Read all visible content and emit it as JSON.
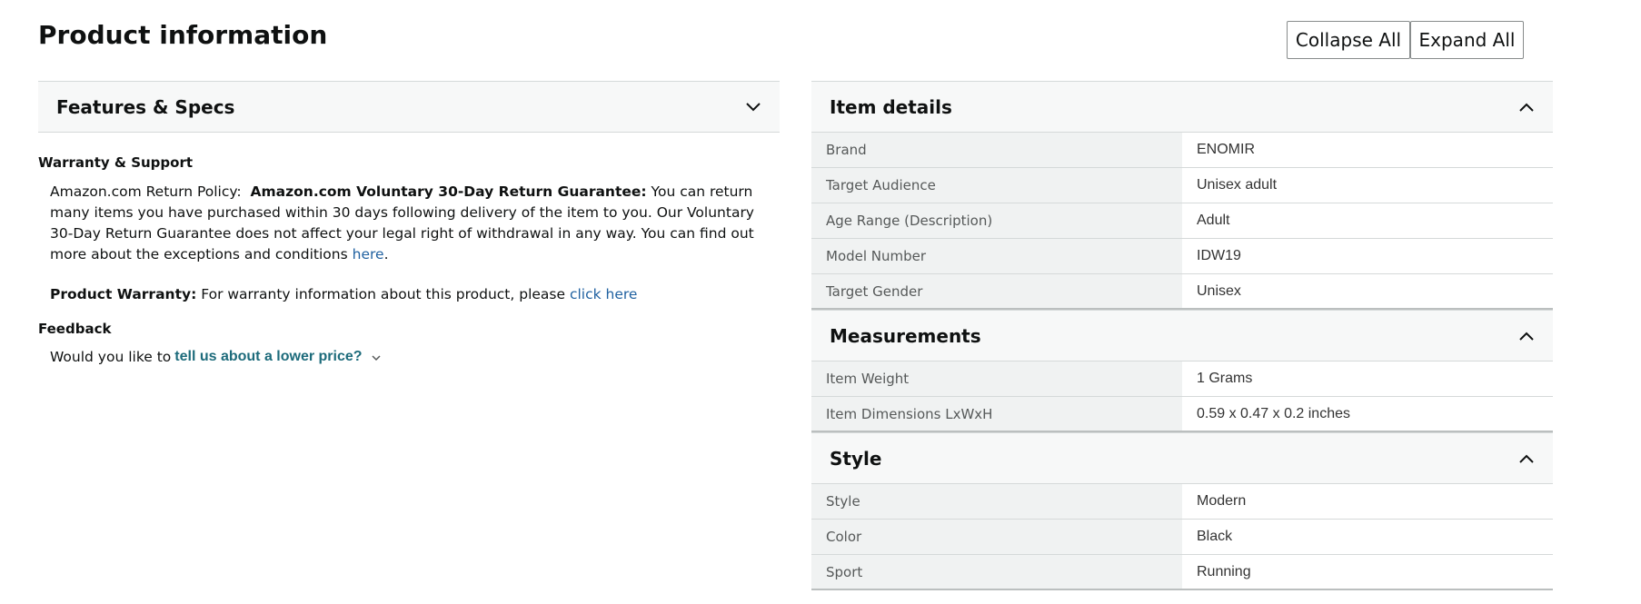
{
  "page": {
    "title": "Product information"
  },
  "buttons": {
    "collapse_all": "Collapse All",
    "expand_all": "Expand All"
  },
  "left": {
    "features_header": "Features & Specs",
    "warranty_support": {
      "title": "Warranty & Support",
      "return_policy_label": "Amazon.com Return Policy:",
      "return_policy_bold": "Amazon.com Voluntary 30-Day Return Guarantee:",
      "return_policy_text": "You can return many items you have purchased within 30 days following delivery of the item to you. Our Voluntary 30-Day Return Guarantee does not affect your legal right of withdrawal in any way. You can find out more about the exceptions and conditions",
      "here_link": "here",
      "period": ".",
      "warranty_label": "Product Warranty:",
      "warranty_text": "For warranty information about this product, please",
      "click_here_link": "click here"
    },
    "feedback": {
      "title": "Feedback",
      "prompt": "Would you like to",
      "link": "tell us about a lower price?"
    }
  },
  "right": {
    "item_details": {
      "header": "Item details",
      "rows": [
        {
          "key": "Brand",
          "value": "ENOMIR"
        },
        {
          "key": "Target Audience",
          "value": "Unisex adult"
        },
        {
          "key": "Age Range (Description)",
          "value": "Adult"
        },
        {
          "key": "Model Number",
          "value": "IDW19"
        },
        {
          "key": "Target Gender",
          "value": "Unisex"
        }
      ]
    },
    "measurements": {
      "header": "Measurements",
      "rows": [
        {
          "key": "Item Weight",
          "value": "1 Grams"
        },
        {
          "key": "Item Dimensions LxWxH",
          "value": "0.59 x 0.47 x 0.2 inches"
        }
      ]
    },
    "style": {
      "header": "Style",
      "rows": [
        {
          "key": "Style",
          "value": "Modern"
        },
        {
          "key": "Color",
          "value": "Black"
        },
        {
          "key": "Sport",
          "value": "Running"
        }
      ]
    }
  }
}
